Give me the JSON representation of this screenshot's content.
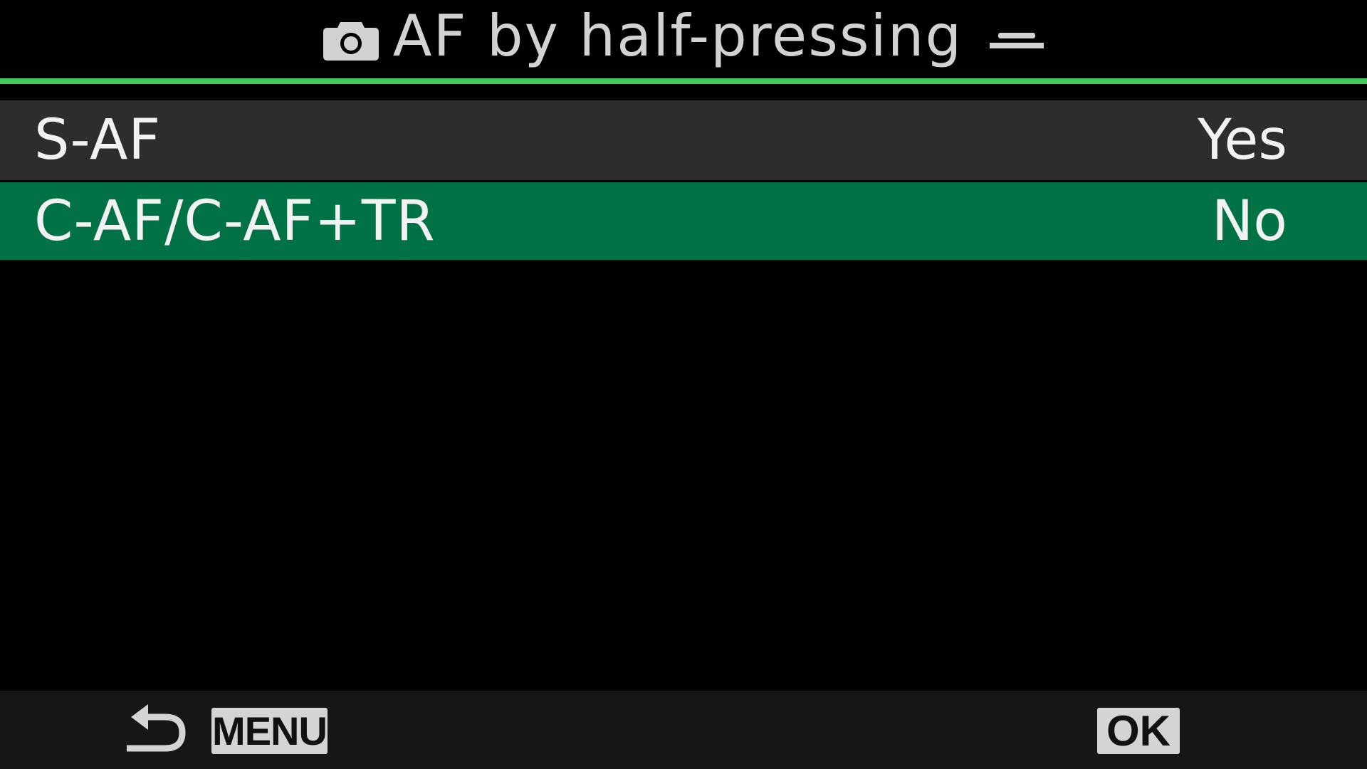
{
  "header": {
    "title": "AF by half-pressing",
    "camera_icon": "camera-icon",
    "halfpress_icon": "shutter-half-press-icon"
  },
  "options": [
    {
      "label": "S-AF",
      "value": "Yes",
      "selected": false
    },
    {
      "label": "C-AF/C-AF+TR",
      "value": "No",
      "selected": true
    }
  ],
  "footer": {
    "back_icon": "return-arrow-icon",
    "menu_label": "MENU",
    "ok_label": "OK"
  },
  "colors": {
    "accent_rule": "#3fce5d",
    "selected_row": "#007246",
    "row_background": "#2d2d2d",
    "text": "#f2f2f2",
    "title_text": "#d2d2d2"
  }
}
